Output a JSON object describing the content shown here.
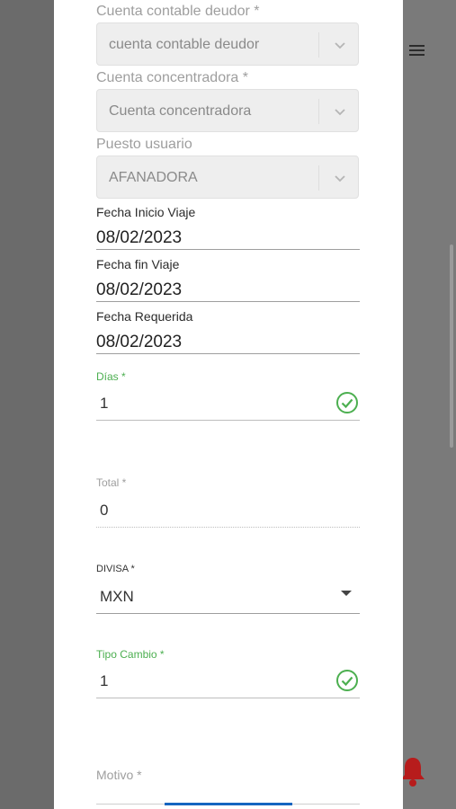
{
  "fields": {
    "cuenta_deudor": {
      "label": "Cuenta contable deudor *",
      "value": "cuenta contable deudor"
    },
    "cuenta_concentradora": {
      "label": "Cuenta concentradora *",
      "value": "Cuenta concentradora"
    },
    "puesto_usuario": {
      "label": "Puesto usuario",
      "value": "AFANADORA"
    },
    "fecha_inicio": {
      "label": "Fecha Inicio Viaje",
      "value": "08/02/2023"
    },
    "fecha_fin": {
      "label": "Fecha fin Viaje",
      "value": "08/02/2023"
    },
    "fecha_requerida": {
      "label": "Fecha Requerida",
      "value": "08/02/2023"
    },
    "dias": {
      "label": "Días *",
      "value": "1"
    },
    "total": {
      "label": "Total *",
      "value": "0"
    },
    "divisa": {
      "label": "DIVISA *",
      "value": "MXN"
    },
    "tipo_cambio": {
      "label": "Tipo Cambio *",
      "value": "1"
    },
    "motivo": {
      "label": "Motivo *"
    }
  },
  "icons": {
    "menu": "hamburger-menu-icon",
    "valid": "check-circle-icon",
    "dropdown": "chevron-down-icon",
    "notification": "bell-icon"
  },
  "colors": {
    "valid_green": "#4caf50",
    "accent_blue": "#1565c0",
    "alert_red": "#b71c1c"
  }
}
